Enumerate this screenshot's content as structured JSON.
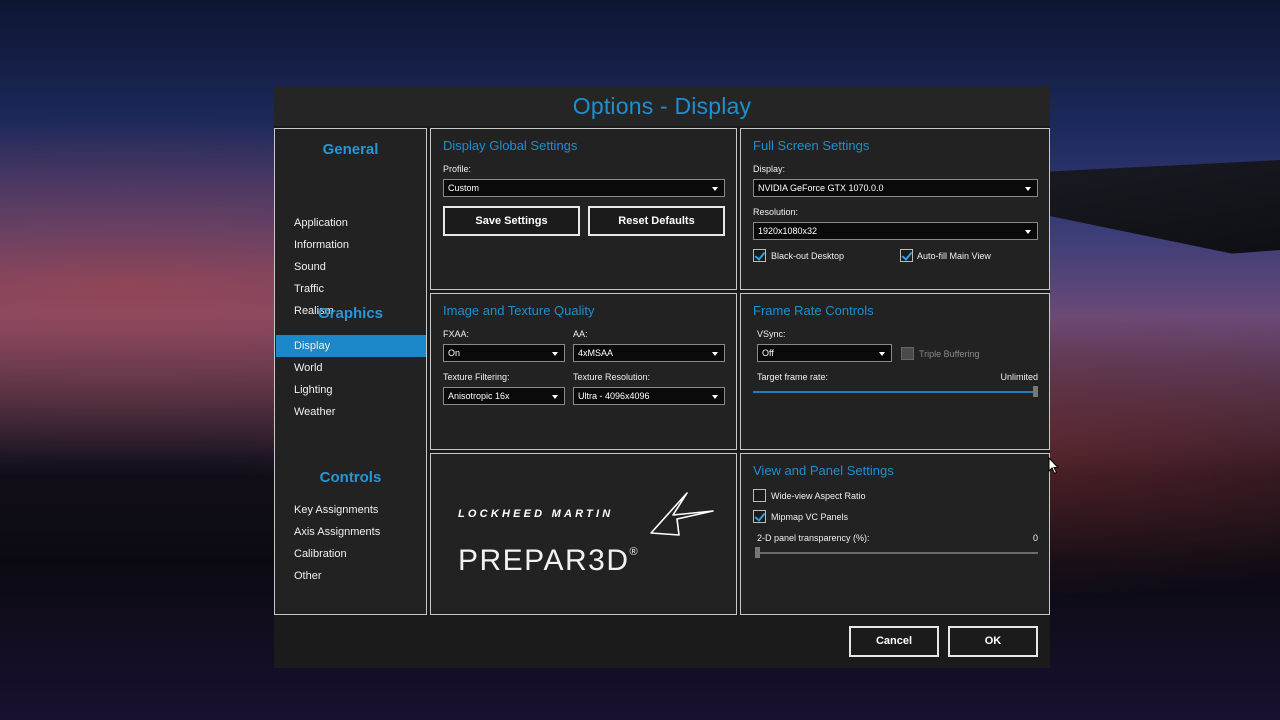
{
  "dialog": {
    "title": "Options - Display"
  },
  "sidebar": {
    "sections": [
      {
        "heading": "General",
        "items": [
          "Application",
          "Information",
          "Sound",
          "Traffic",
          "Realism"
        ]
      },
      {
        "heading": "Graphics",
        "items": [
          "Display",
          "World",
          "Lighting",
          "Weather"
        ]
      },
      {
        "heading": "Controls",
        "items": [
          "Key Assignments",
          "Axis Assignments",
          "Calibration",
          "Other"
        ]
      }
    ],
    "active_item": "Display"
  },
  "display_global": {
    "title": "Display Global Settings",
    "profile_label": "Profile:",
    "profile_value": "Custom",
    "save_label": "Save Settings",
    "reset_label": "Reset Defaults"
  },
  "full_screen": {
    "title": "Full Screen Settings",
    "display_label": "Display:",
    "display_value": "NVIDIA GeForce GTX 1070.0.0",
    "resolution_label": "Resolution:",
    "resolution_value": "1920x1080x32",
    "blackout_label": "Black-out Desktop",
    "blackout_checked": true,
    "autofill_label": "Auto-fill Main View",
    "autofill_checked": true
  },
  "image_quality": {
    "title": "Image and Texture Quality",
    "fxaa_label": "FXAA:",
    "fxaa_value": "On",
    "aa_label": "AA:",
    "aa_value": "4xMSAA",
    "filtering_label": "Texture Filtering:",
    "filtering_value": "Anisotropic 16x",
    "resolution_label": "Texture Resolution:",
    "resolution_value": "Ultra - 4096x4096"
  },
  "frame_rate": {
    "title": "Frame Rate Controls",
    "vsync_label": "VSync:",
    "vsync_value": "Off",
    "triple_label": "Triple Buffering",
    "triple_checked": false,
    "target_label": "Target frame rate:",
    "target_value": "Unlimited",
    "target_fraction": 1.0
  },
  "logo": {
    "company": "LOCKHEED MARTIN",
    "product": "PREPAR3D",
    "mark": "®"
  },
  "view_panel": {
    "title": "View and Panel Settings",
    "wide_label": "Wide-view Aspect Ratio",
    "wide_checked": false,
    "mipmap_label": "Mipmap VC Panels",
    "mipmap_checked": true,
    "transparency_label": "2-D panel transparency (%):",
    "transparency_value": "0",
    "transparency_fraction": 0.0
  },
  "footer": {
    "cancel_label": "Cancel",
    "ok_label": "OK"
  },
  "colors": {
    "accent": "#1e8fd0",
    "active_item": "#1c87c9",
    "dialog_bg": "#1b1b1b",
    "panel_bg": "#222222"
  },
  "icons": {
    "dropdown": "chevron-down-icon",
    "check": "checkmark-icon",
    "cursor": "mouse-pointer-icon"
  }
}
